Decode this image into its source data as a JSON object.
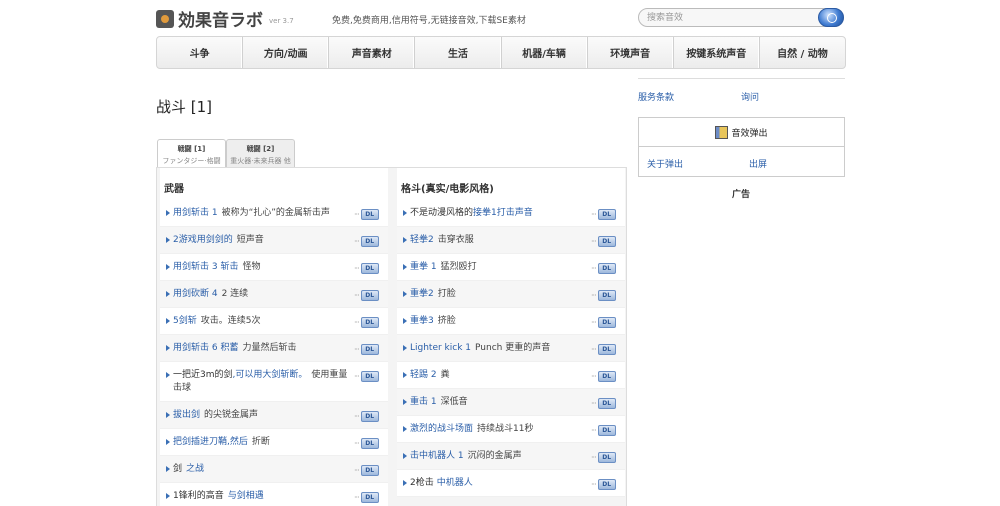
{
  "header": {
    "logo_text": "効果音ラボ",
    "version": "ver 3.7",
    "tagline": "免费,免费商用,信用符号,无链接音效,下载SE素材",
    "search_placeholder": "搜索音效"
  },
  "nav": {
    "items": [
      {
        "label": "斗争"
      },
      {
        "label": "方向/动画"
      },
      {
        "label": "声音素材"
      },
      {
        "label": "生活"
      },
      {
        "label": "机器/车辆"
      },
      {
        "label": "环境声音"
      },
      {
        "label": "按键系统声音"
      },
      {
        "label": "自然 / 动物"
      }
    ]
  },
  "page": {
    "title": "战斗 [1]"
  },
  "tabs": [
    {
      "label": "戦闘 [1]",
      "sub": "ファンタジー·格闘"
    },
    {
      "label": "戦闘 [2]",
      "sub": "重火器·未来兵器 他"
    }
  ],
  "left_column": {
    "heading": "武器",
    "rows": [
      {
        "link": "用剑斩击 1",
        "desc": "被称为“扎心”的金属斩击声"
      },
      {
        "link": "2游戏用剑剑的",
        "desc": "短声音"
      },
      {
        "link": "用剑斩击 3 斩击",
        "desc": "怪物"
      },
      {
        "link": "用剑砍断 4",
        "desc": "2 连续"
      },
      {
        "link": "5剑斩",
        "desc": "攻击。连续5次"
      },
      {
        "link": "用剑斩击 6 积蓄",
        "desc": "力量然后斩击"
      },
      {
        "pre": "一把近3m的剑",
        "link": ",可以用大剑斩断。",
        "desc": "使用重量击球"
      },
      {
        "link": "拔出剑",
        "desc": "的尖锐金属声"
      },
      {
        "link": "把剑插进刀鞘,然后",
        "desc": "折断"
      },
      {
        "pre": "剑",
        "link": "之战",
        "desc": ""
      },
      {
        "pre": "1锋利的高音",
        "link": "与剑相遇",
        "desc": ""
      }
    ]
  },
  "right_column": {
    "heading": "格斗(真实/电影风格)",
    "rows": [
      {
        "pre": "不是动漫风格的",
        "link": "接拳1打击声音",
        "desc": ""
      },
      {
        "link": "轻拳2",
        "desc": "击穿衣服"
      },
      {
        "link": "重拳 1",
        "desc": "猛烈殴打"
      },
      {
        "link": "重拳2",
        "desc": "打脸"
      },
      {
        "link": "重拳3",
        "desc": "挤脸"
      },
      {
        "link": "Lighter kick 1",
        "desc": "Punch 更重的声音"
      },
      {
        "link": "轻踢 2",
        "desc": "粪"
      },
      {
        "link": "重击 1",
        "desc": "深低音"
      },
      {
        "link": "激烈的战斗场面",
        "desc": "持续战斗11秒"
      },
      {
        "link": "击中机器人 1",
        "desc": "沉闷的金属声"
      },
      {
        "pre": "2枪击",
        "link": "中机器人",
        "desc": ""
      }
    ]
  },
  "dl_label": "DL",
  "sidebar": {
    "terms": "服务条款",
    "inquiry": "询问",
    "popup_title": "音效弹出",
    "about_popup": "关于弹出",
    "show_screen": "出屏",
    "ad": "广告"
  }
}
